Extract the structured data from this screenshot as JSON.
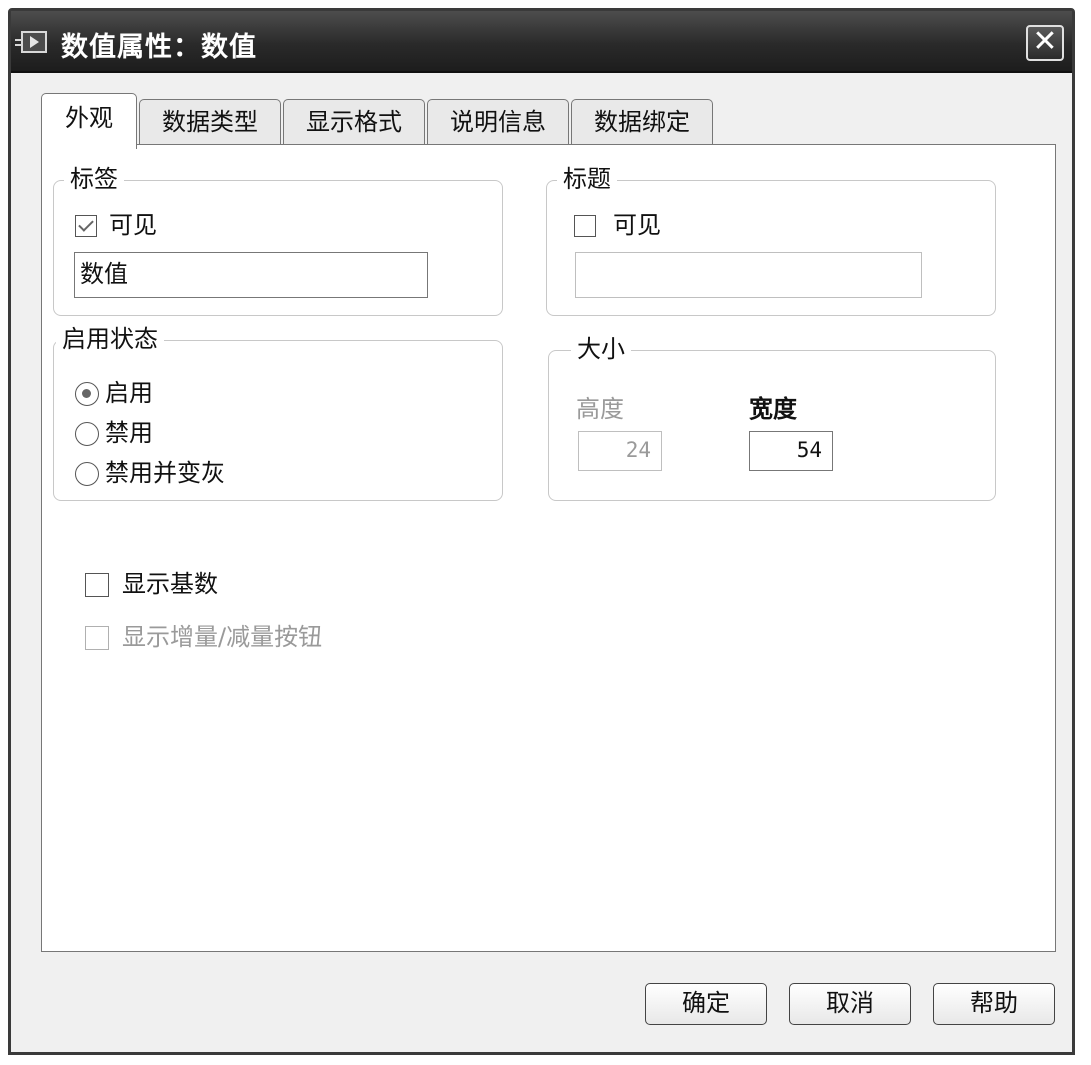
{
  "window": {
    "title": "数值属性：数值",
    "close_label": "✕"
  },
  "tabs": [
    {
      "label": "外观",
      "active": true
    },
    {
      "label": "数据类型",
      "active": false
    },
    {
      "label": "显示格式",
      "active": false
    },
    {
      "label": "说明信息",
      "active": false
    },
    {
      "label": "数据绑定",
      "active": false
    }
  ],
  "label_group": {
    "title": "标签",
    "visible_label": "可见",
    "visible_checked": true,
    "text_value": "数值"
  },
  "caption_group": {
    "title": "标题",
    "visible_label": "可见",
    "visible_checked": false,
    "text_value": ""
  },
  "enable_state": {
    "title": "启用状态",
    "options": [
      {
        "label": "启用",
        "selected": true
      },
      {
        "label": "禁用",
        "selected": false
      },
      {
        "label": "禁用并变灰",
        "selected": false
      }
    ]
  },
  "size_group": {
    "title": "大小",
    "height_label": "高度",
    "height_value": "24",
    "width_label": "宽度",
    "width_value": "54"
  },
  "options": {
    "show_radix_label": "显示基数",
    "show_radix_checked": false,
    "show_incdec_label": "显示增量/减量按钮",
    "show_incdec_checked": false
  },
  "buttons": {
    "ok": "确定",
    "cancel": "取消",
    "help": "帮助"
  }
}
